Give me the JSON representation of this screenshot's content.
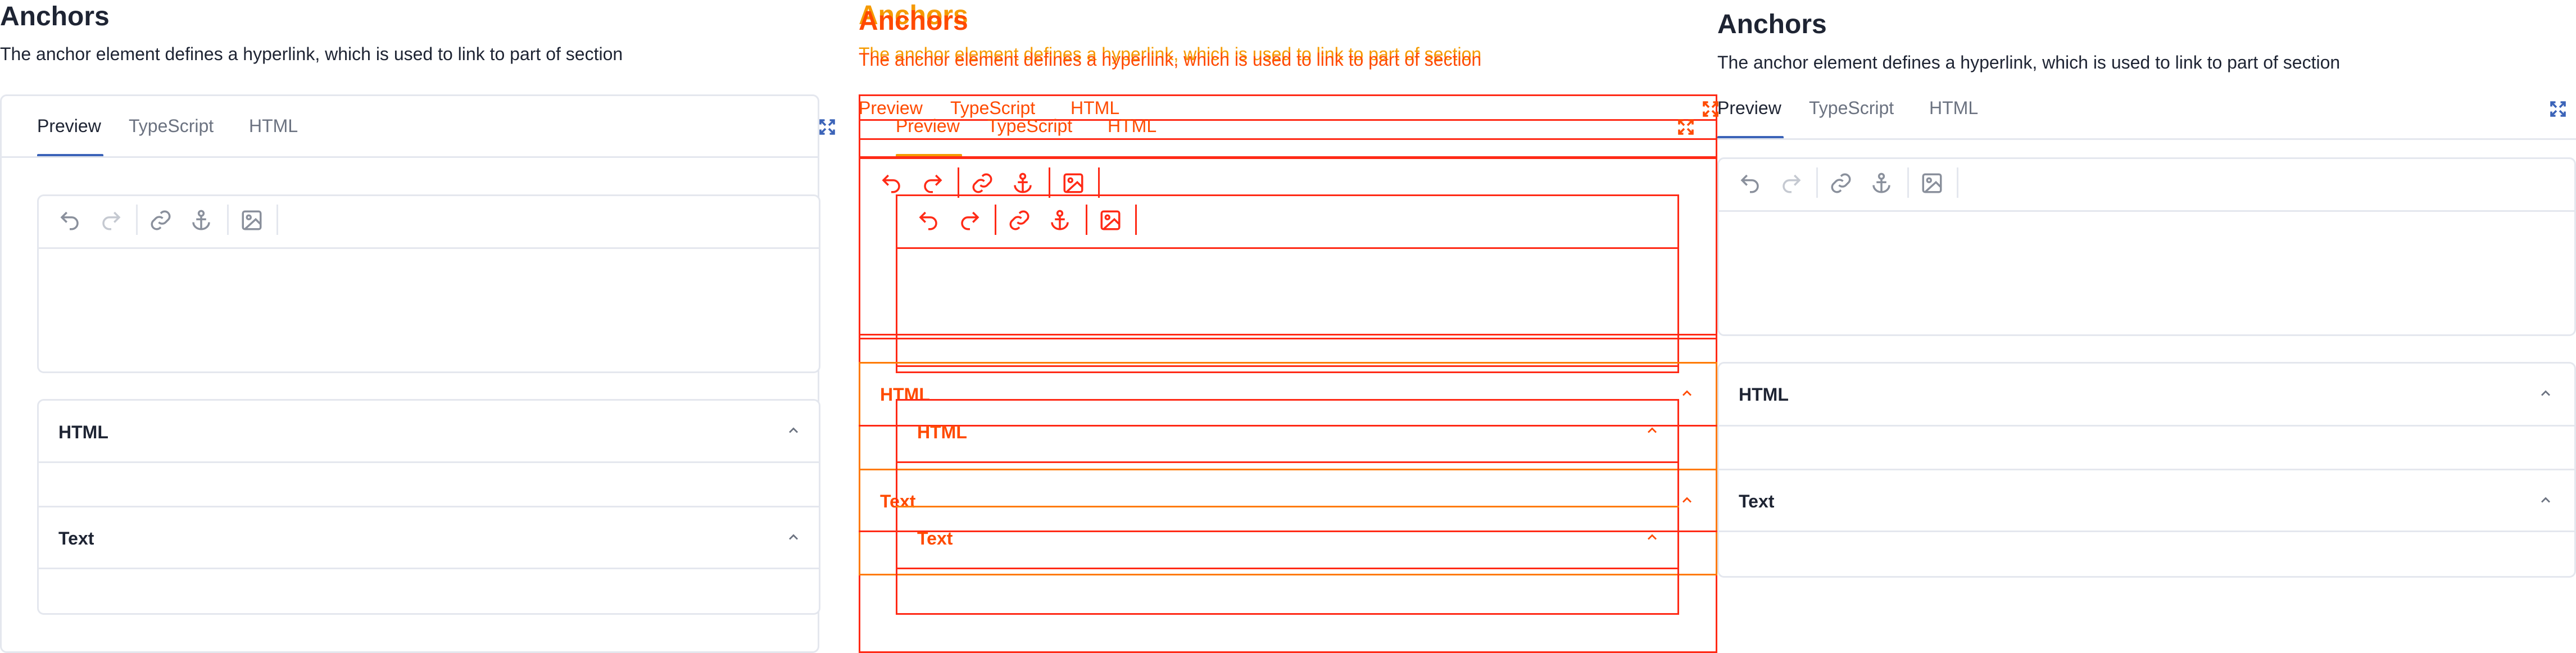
{
  "page": {
    "title": "Anchors",
    "description": "The anchor element defines a hyperlink, which is used to link to part of section"
  },
  "tabs": [
    {
      "label": "Preview",
      "active": true
    },
    {
      "label": "TypeScript",
      "active": false
    },
    {
      "label": "HTML",
      "active": false
    }
  ],
  "toolbar": {
    "buttons": [
      {
        "name": "undo",
        "icon": "undo-icon",
        "enabled": true
      },
      {
        "name": "redo",
        "icon": "redo-icon",
        "enabled": false
      },
      {
        "name": "link",
        "icon": "link-icon",
        "enabled": true
      },
      {
        "name": "anchor",
        "icon": "anchor-icon",
        "enabled": true
      },
      {
        "name": "image",
        "icon": "image-icon",
        "enabled": true
      }
    ]
  },
  "fullscreen_icon": "expand-icon",
  "sections": [
    {
      "title": "HTML",
      "expanded": true
    },
    {
      "title": "Text",
      "expanded": true
    }
  ],
  "colors": {
    "accent": "#3b63b8",
    "text": "#1e2433",
    "muted": "#6b7280",
    "border": "#e4e7ee",
    "overlay_primary": "#ff2a16",
    "overlay_secondary": "#ff7a00"
  }
}
